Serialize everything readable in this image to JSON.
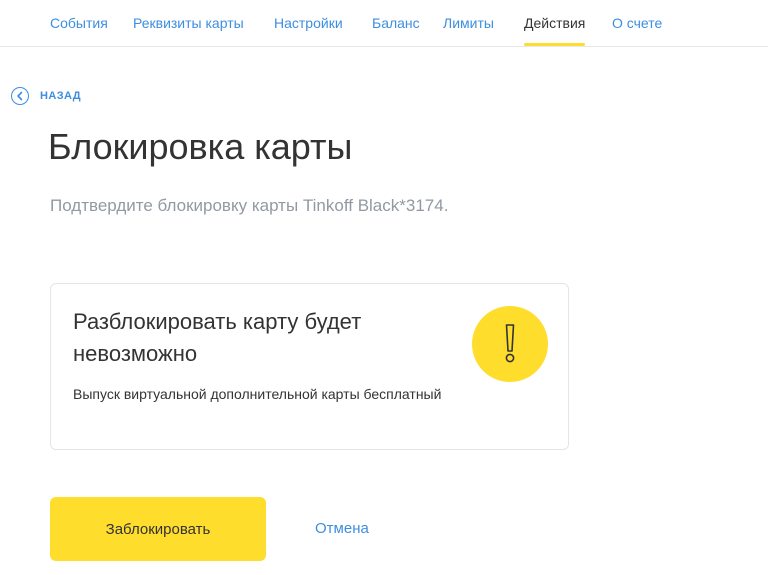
{
  "tabs": [
    {
      "label": "События",
      "active": false
    },
    {
      "label": "Реквизиты карты",
      "active": false
    },
    {
      "label": "Настройки",
      "active": false
    },
    {
      "label": "Баланс",
      "active": false
    },
    {
      "label": "Лимиты",
      "active": false
    },
    {
      "label": "Действия",
      "active": true
    },
    {
      "label": "О счете",
      "active": false
    }
  ],
  "back": {
    "label": "НАЗАД",
    "icon": "chevron-left-icon"
  },
  "page": {
    "title": "Блокировка карты",
    "subtitle": "Подтвердите блокировку карты Tinkoff Black*3174."
  },
  "warning": {
    "heading": "Разблокировать карту будет невозможно",
    "text": "Выпуск виртуальной дополнительной карты бесплатный",
    "icon": "exclamation-icon"
  },
  "actions": {
    "confirm_label": "Заблокировать",
    "cancel_label": "Отмена"
  },
  "colors": {
    "accent": "#ffdd2d",
    "link": "#3d8ee1",
    "text": "#333333",
    "muted": "#9299a2"
  }
}
